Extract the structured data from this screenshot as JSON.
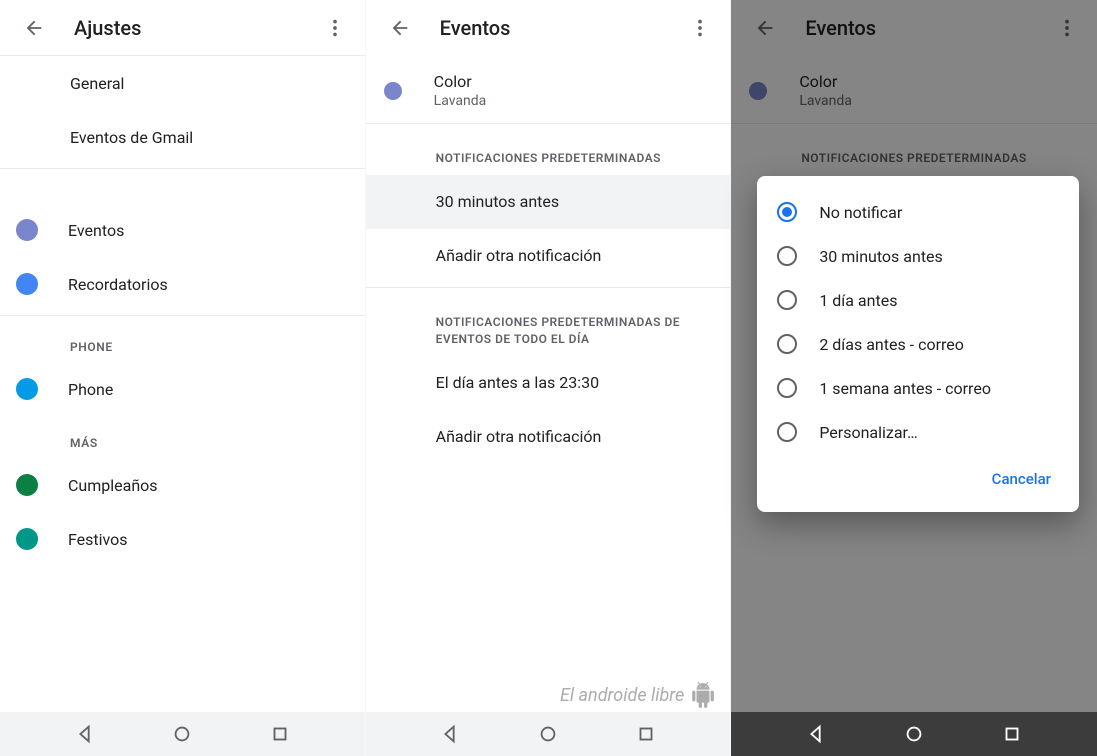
{
  "watermark": "El androide libre",
  "screen1": {
    "title": "Ajustes",
    "items": {
      "general": "General",
      "gmail_events": "Eventos de Gmail",
      "eventos": "Eventos",
      "recordatorios": "Recordatorios",
      "phone_header": "PHONE",
      "phone": "Phone",
      "mas_header": "MÁS",
      "cumple": "Cumpleaños",
      "festivos": "Festivos"
    },
    "colors": {
      "eventos": "#7986cb",
      "recordatorios": "#4285f4",
      "phone": "#039be5",
      "cumple": "#0b8043",
      "festivos": "#009688"
    }
  },
  "screen2": {
    "title": "Eventos",
    "color_label": "Color",
    "color_value": "Lavanda",
    "color_swatch": "#7986cb",
    "section_notif": "NOTIFICACIONES PREDETERMINADAS",
    "notif_selected": "30 minutos antes",
    "add_notif": "Añadir otra notificación",
    "section_allday": "NOTIFICACIONES PREDETERMINADAS DE EVENTOS DE TODO EL DÍA",
    "allday_value": "El día antes a las 23:30"
  },
  "screen3": {
    "title": "Eventos",
    "color_label": "Color",
    "color_value": "Lavanda",
    "color_swatch": "#7986cb",
    "section_notif": "NOTIFICACIONES PREDETERMINADAS",
    "dialog": {
      "options": [
        "No notificar",
        "30 minutos antes",
        "1 día antes",
        "2 días antes - correo",
        "1 semana antes - correo",
        "Personalizar…"
      ],
      "selected_index": 0,
      "cancel": "Cancelar"
    }
  }
}
